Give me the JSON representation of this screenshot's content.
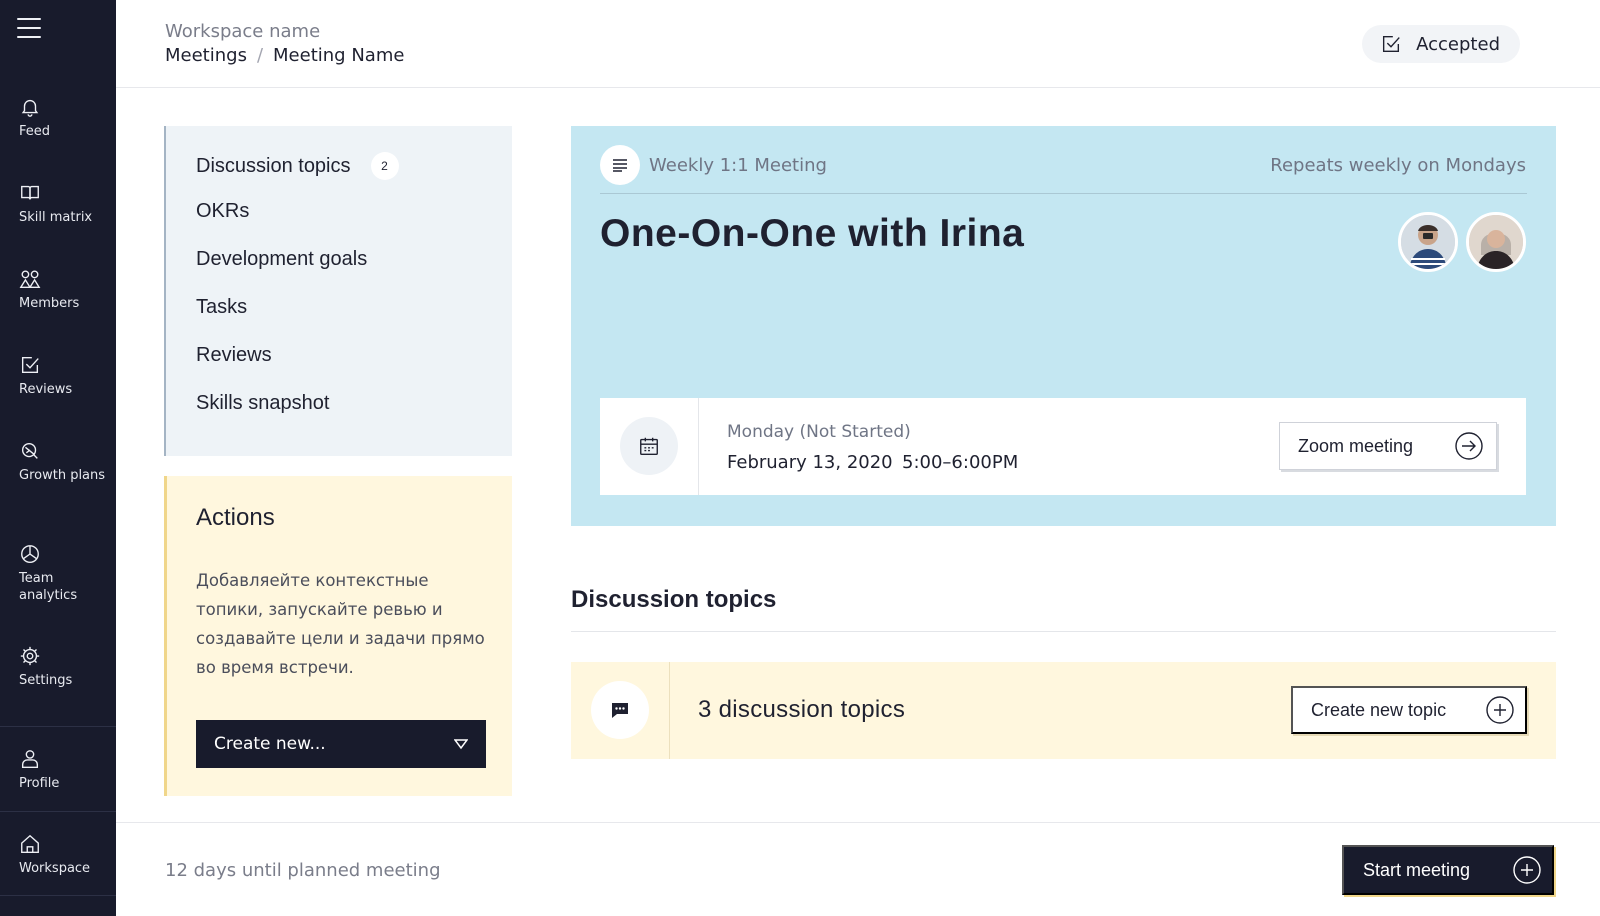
{
  "sidebar": {
    "items": [
      {
        "label": "Feed",
        "icon": "bell-icon"
      },
      {
        "label": "Skill matrix",
        "icon": "book-icon"
      },
      {
        "label": "Members",
        "icon": "members-icon"
      },
      {
        "label": "Reviews",
        "icon": "check-square-icon"
      },
      {
        "label": "Growth plans",
        "icon": "growth-icon"
      },
      {
        "label": "Team analytics",
        "icon": "analytics-icon"
      },
      {
        "label": "Settings",
        "icon": "gear-icon"
      },
      {
        "label": "Profile",
        "icon": "user-icon"
      },
      {
        "label": "Workspace",
        "icon": "home-icon"
      }
    ]
  },
  "header": {
    "workspace_name": "Workspace name",
    "breadcrumb": [
      "Meetings",
      "Meeting Name"
    ],
    "breadcrumb_sep": "/",
    "status": "Accepted"
  },
  "topics_nav": {
    "items": [
      {
        "label": "Discussion topics",
        "badge": "2"
      },
      {
        "label": "OKRs"
      },
      {
        "label": "Development goals"
      },
      {
        "label": "Tasks"
      },
      {
        "label": "Reviews"
      },
      {
        "label": "Skills snapshot"
      }
    ]
  },
  "actions": {
    "title": "Actions",
    "text": "Добавляейте контекстные топики, запускайте ревью и создавайте цели и задачи прямо во время встречи.",
    "create_label": "Create new..."
  },
  "meeting": {
    "type": "Weekly 1:1 Meeting",
    "repeat": "Repeats weekly on Mondays",
    "title": "One-On-One with Irina",
    "day_status": "Monday (Not Started)",
    "date": "February 13, 2020",
    "time": "5:00–6:00PM",
    "zoom_label": "Zoom meeting"
  },
  "discussion": {
    "heading": "Discussion topics",
    "count_label": "3 discussion topics",
    "create_label": "Create new topic"
  },
  "footer": {
    "countdown": "12 days until planned meeting",
    "start_label": "Start meeting"
  },
  "colors": {
    "sidebar_bg": "#181b2c",
    "meeting_card_bg": "#c4e7f2",
    "actions_bg": "#fff7de",
    "topics_nav_bg": "#eef3f7"
  }
}
